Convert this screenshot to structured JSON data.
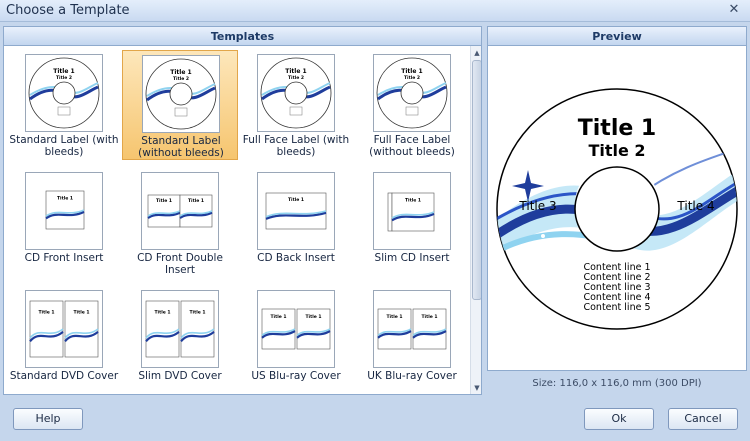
{
  "window": {
    "title": "Choose a Template"
  },
  "templates_header": "Templates",
  "preview_header": "Preview",
  "templates": [
    {
      "label": "Standard Label (with bleeds)",
      "kind": "disc",
      "selected": false
    },
    {
      "label": "Standard Label (without bleeds)",
      "kind": "disc",
      "selected": true
    },
    {
      "label": "Full Face Label (with bleeds)",
      "kind": "disc",
      "selected": false
    },
    {
      "label": "Full Face Label (without bleeds)",
      "kind": "disc",
      "selected": false
    },
    {
      "label": "CD Front Insert",
      "kind": "front",
      "selected": false
    },
    {
      "label": "CD Front Double Insert",
      "kind": "double",
      "selected": false
    },
    {
      "label": "CD Back Insert",
      "kind": "back",
      "selected": false
    },
    {
      "label": "Slim CD Insert",
      "kind": "slim",
      "selected": false
    },
    {
      "label": "Standard DVD Cover",
      "kind": "dvd",
      "selected": false
    },
    {
      "label": "Slim DVD Cover",
      "kind": "dvd",
      "selected": false
    },
    {
      "label": "US Blu-ray Cover",
      "kind": "bluray",
      "selected": false
    },
    {
      "label": "UK Blu-ray Cover",
      "kind": "bluray",
      "selected": false
    }
  ],
  "preview": {
    "title1": "Title 1",
    "title2": "Title 2",
    "title3": "Title 3",
    "title4": "Title 4",
    "content_lines": [
      "Content line 1",
      "Content line 2",
      "Content line 3",
      "Content line 4",
      "Content line 5"
    ]
  },
  "size_text": "Size: 116,0 x 116,0 mm (300 DPI)",
  "buttons": {
    "help": "Help",
    "ok": "Ok",
    "cancel": "Cancel"
  },
  "colors": {
    "accent_blue": "#1f3d9c",
    "wave_light": "#8fd3f0",
    "selection": "#f6c56f"
  }
}
